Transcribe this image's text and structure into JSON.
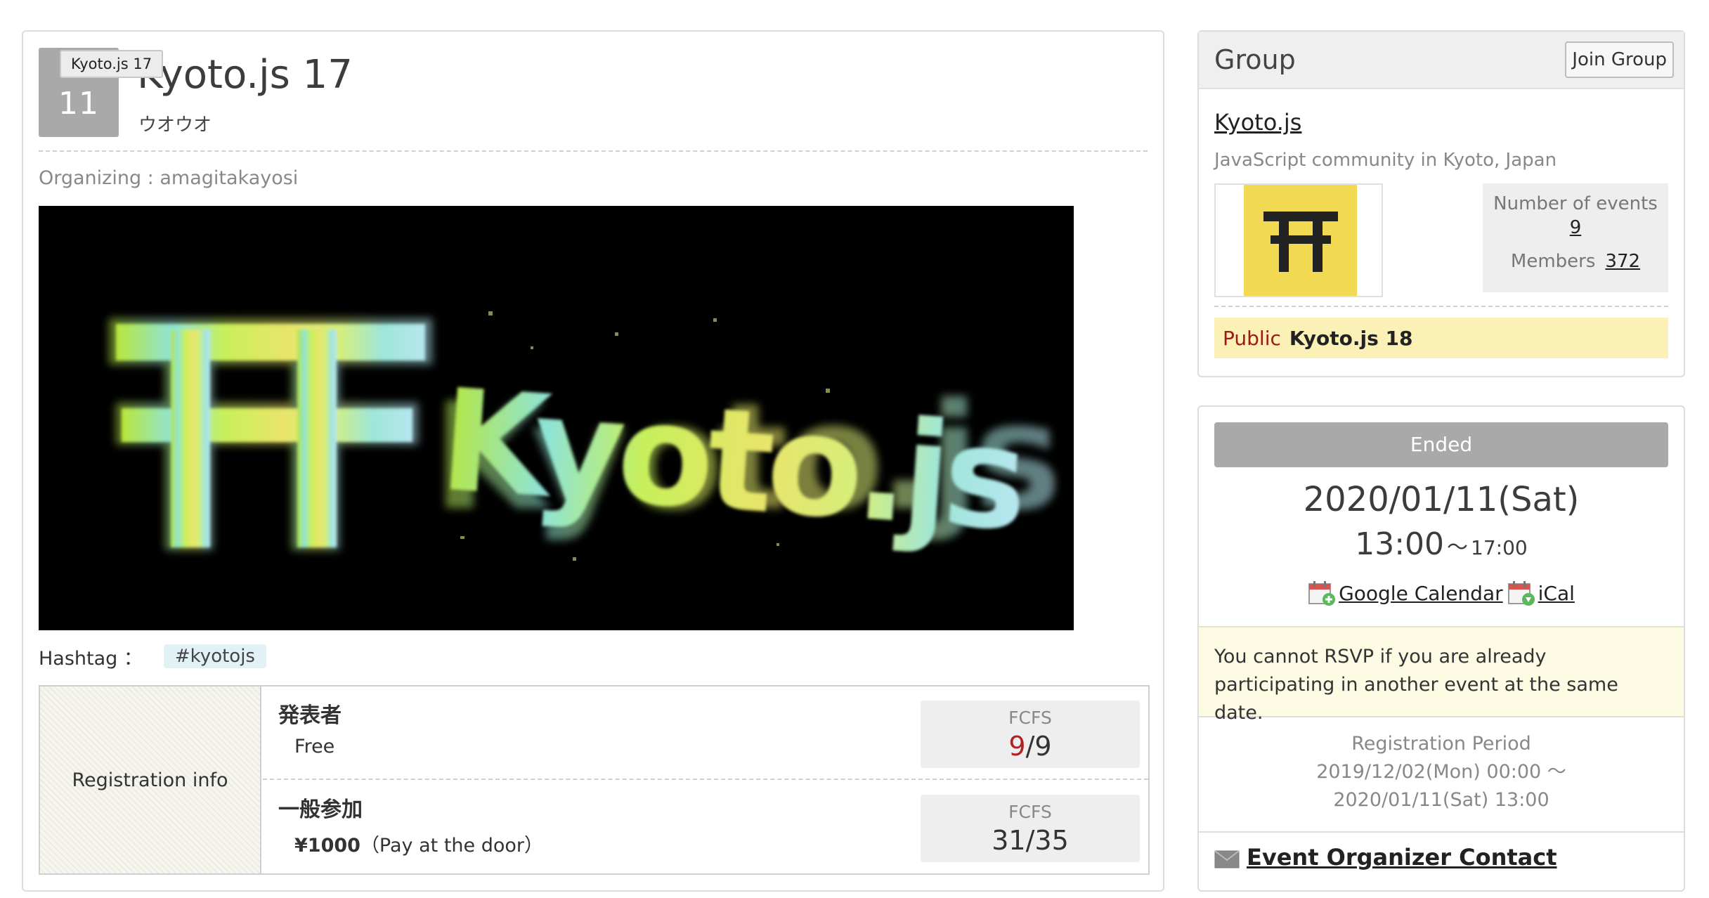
{
  "event": {
    "day": "11",
    "tooltip": "Kyoto.js 17",
    "title": "Kyoto.js 17",
    "subtitle": "ウオウオ",
    "organizing": "Organizing : amagitakayosi",
    "image_text": "Kyoto.js",
    "hashtag_label": "Hashtag ：",
    "hashtag": "#kyotojs"
  },
  "registration": {
    "header": "Registration info",
    "tickets": [
      {
        "name": "発表者",
        "price": "Free",
        "price_note": "",
        "label": "FCFS",
        "filled": "9",
        "total": "/9"
      },
      {
        "name": "一般参加",
        "price": "¥1000",
        "price_note": "（Pay at the door）",
        "label": "FCFS",
        "filled": "31",
        "total": "/35"
      }
    ]
  },
  "group": {
    "header": "Group",
    "join_label": "Join Group",
    "name": "Kyoto.js",
    "description": "JavaScript community in Kyoto, Japan",
    "events_label": "Number of events",
    "events_count": "9",
    "members_label": "Members",
    "members_count": "372",
    "next_event_status": "Public",
    "next_event_name": "Kyoto.js 18"
  },
  "info": {
    "status": "Ended",
    "date": "2020/01/11(Sat)",
    "time_start": "13:00",
    "time_sep": "～",
    "time_end": "17:00",
    "google_calendar": "Google Calendar",
    "ical": "iCal",
    "rsvp_note": "You cannot RSVP if you are already participating in another event at the same date.",
    "reg_period_label": "Registration Period",
    "reg_period_start": "2019/12/02(Mon) 00:00 ～",
    "reg_period_end": "2020/01/11(Sat) 13:00",
    "contact": "Event Organizer Contact"
  },
  "colors": {
    "badge_gray": "#a9a9a9",
    "filled_red": "#b22222",
    "group_logo_yellow": "#f1d952",
    "next_event_bg": "#fbf0b5",
    "note_bg": "#fdfbe3",
    "hashtag_bg": "#e2f1f6"
  },
  "icons": [
    "torii-icon",
    "calendar-add-icon",
    "calendar-download-icon",
    "mail-icon"
  ]
}
